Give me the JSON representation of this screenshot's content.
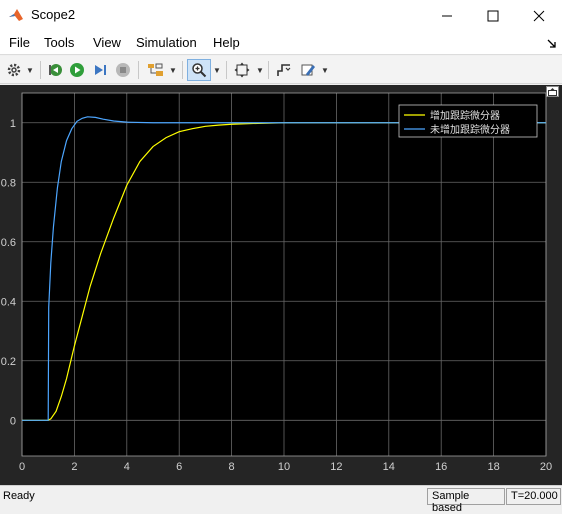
{
  "window": {
    "title": "Scope2",
    "icons": {
      "app": "matlab-icon",
      "minimize": "minimize-icon",
      "maximize": "maximize-icon",
      "close": "close-icon"
    }
  },
  "menubar": {
    "items": [
      "File",
      "Tools",
      "View",
      "Simulation",
      "Help"
    ],
    "pin_icon": "arrow-pin-icon"
  },
  "toolbar": {
    "icons": [
      "settings-icon",
      "step-back-icon",
      "run-icon",
      "step-forward-icon",
      "stop-icon",
      "highlight-simulink-block-icon",
      "zoom-in-icon",
      "fit-to-view-icon",
      "triggers-icon",
      "style-icon"
    ],
    "active": "zoom-in-icon"
  },
  "scope": {
    "background": "#000000",
    "frame_background": "#252525",
    "grid_color": "#686868",
    "undock_icon": "undock-icon"
  },
  "statusbar": {
    "status": "Ready",
    "sample_mode": "Sample based",
    "time": "T=20.000"
  },
  "chart_data": {
    "type": "line",
    "title": "",
    "xlabel": "",
    "ylabel": "",
    "xlim": [
      0,
      20
    ],
    "ylim": [
      -0.12,
      1.1
    ],
    "xticks": [
      0,
      2,
      4,
      6,
      8,
      10,
      12,
      14,
      16,
      18,
      20
    ],
    "yticks": [
      0,
      0.2,
      0.4,
      0.6,
      0.8,
      1
    ],
    "grid": true,
    "legend": "top-right",
    "series": [
      {
        "name": "增加跟踪微分器",
        "color": "#ffff00",
        "x": [
          0,
          1,
          1.1,
          1.3,
          1.5,
          1.7,
          2.0,
          2.3,
          2.6,
          3.0,
          3.5,
          4.0,
          4.5,
          5.0,
          5.5,
          6.0,
          6.5,
          7.0,
          7.5,
          8.0,
          9.0,
          10.0,
          12.0,
          14.0,
          16.0,
          18.0,
          20.0
        ],
        "y": [
          0,
          0,
          0.005,
          0.03,
          0.08,
          0.14,
          0.25,
          0.35,
          0.45,
          0.56,
          0.68,
          0.79,
          0.87,
          0.92,
          0.95,
          0.97,
          0.98,
          0.988,
          0.992,
          0.995,
          0.998,
          1.0,
          1.0,
          1.0,
          1.0,
          1.0,
          1.0
        ]
      },
      {
        "name": "未增加跟踪微分器",
        "color": "#4da6ff",
        "x": [
          0,
          1,
          1.02,
          1.1,
          1.2,
          1.35,
          1.5,
          1.7,
          1.9,
          2.1,
          2.3,
          2.5,
          2.8,
          3.1,
          3.5,
          4.0,
          5.0,
          6.0,
          8.0,
          10.0,
          14.0,
          20.0
        ],
        "y": [
          0,
          0,
          0.38,
          0.53,
          0.65,
          0.78,
          0.87,
          0.94,
          0.98,
          1.005,
          1.015,
          1.02,
          1.018,
          1.012,
          1.006,
          1.002,
          1.0,
          1.0,
          1.0,
          1.0,
          1.0,
          1.0
        ]
      }
    ]
  }
}
